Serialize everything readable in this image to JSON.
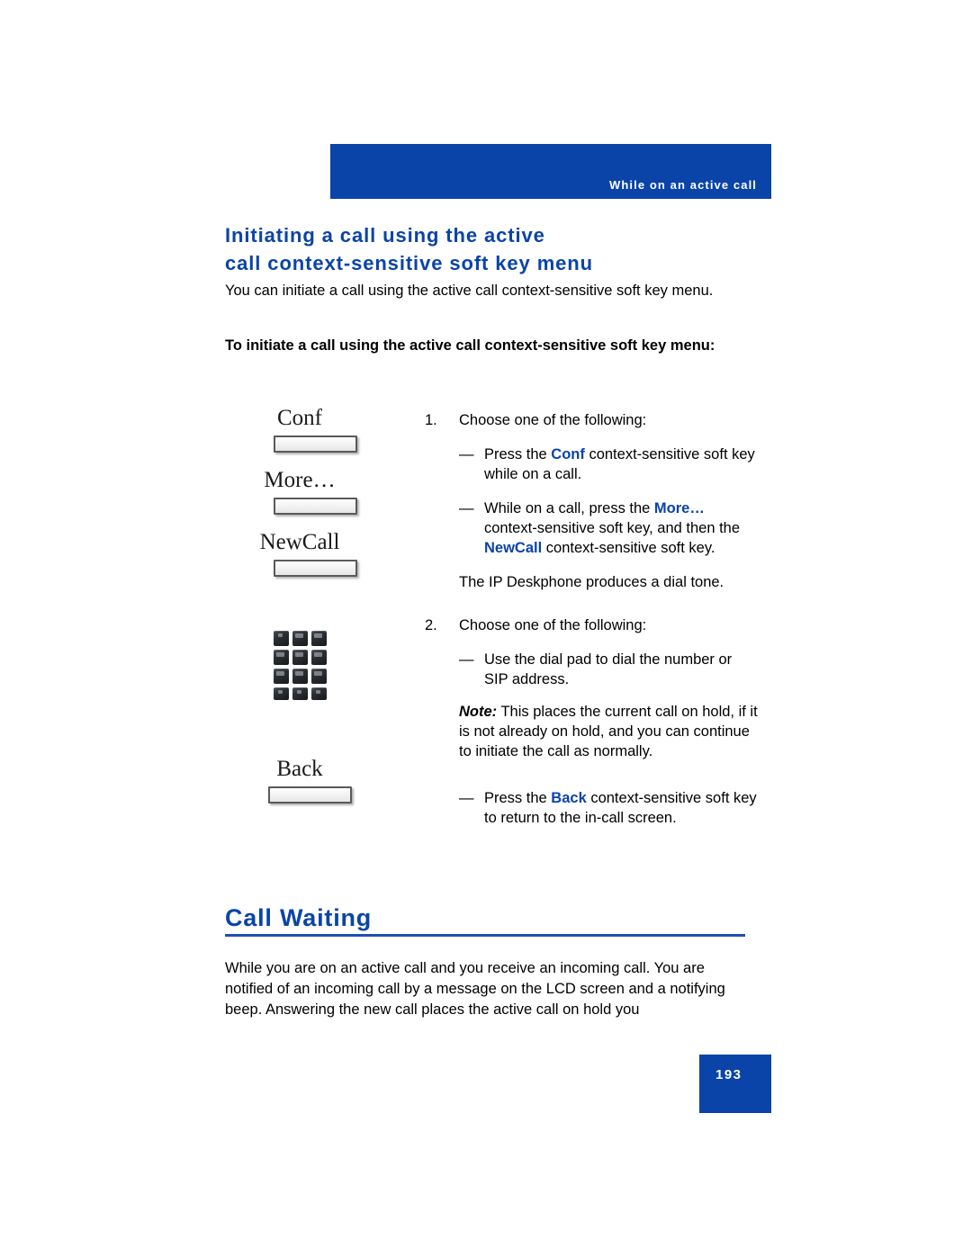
{
  "header": {
    "running_head": "While on an active call",
    "bar_color": "#0a44a8"
  },
  "section": {
    "title_line1": "Initiating a call using the active",
    "title_line2": "call context-sensitive soft key menu",
    "intro": "You can initiate a call using the active call context-sensitive soft key menu.",
    "lead_in": "To initiate a call using the active call context-sensitive soft key menu:"
  },
  "softkeys": [
    {
      "label": "Conf",
      "name": "conf"
    },
    {
      "label": "More…",
      "name": "more"
    },
    {
      "label": "NewCall",
      "name": "newcall"
    }
  ],
  "dialpad": {
    "icon_name": "dial-pad-icon",
    "rows": 4,
    "cols": 3
  },
  "back_softkey": {
    "label": "Back",
    "name": "back"
  },
  "steps": [
    {
      "number": "1.",
      "text": "Choose one of the following:",
      "dash_items": [
        {
          "dash": "—",
          "pre": "Press the ",
          "kw1": "Conf",
          "mid": " context-sensitive soft key while on a call.",
          "kw2": "",
          "post": ""
        },
        {
          "dash": "—",
          "pre": "While on a call, press the ",
          "kw1": "More…",
          "mid": " context-sensitive soft key, and then the ",
          "kw2": "NewCall",
          "post": " context-sensitive soft key."
        }
      ],
      "trailing": "The IP Deskphone produces a dial tone."
    },
    {
      "number": "2.",
      "text": "Choose one of the following:",
      "dash_items": [
        {
          "dash": "—",
          "pre": "Use the dial pad to dial the number or SIP address.",
          "kw1": "",
          "mid": "",
          "kw2": "",
          "post": ""
        }
      ],
      "note": {
        "lead": "Note:",
        "body": " This places the current call on hold, if it is not already on hold, and you can continue to initiate the call as normally."
      },
      "dash_items2": [
        {
          "dash": "—",
          "pre": "Press the ",
          "kw1": "Back",
          "mid": " context-sensitive soft key to return to the in-call screen.",
          "kw2": "",
          "post": ""
        }
      ]
    }
  ],
  "call_waiting": {
    "heading": "Call Waiting",
    "paragraph": "While you are on an active call and you receive an incoming call. You are notified of an incoming call by a message on the LCD screen and a notifying beep. Answering the new call places the active call on hold you"
  },
  "footer": {
    "page_number": "193"
  }
}
